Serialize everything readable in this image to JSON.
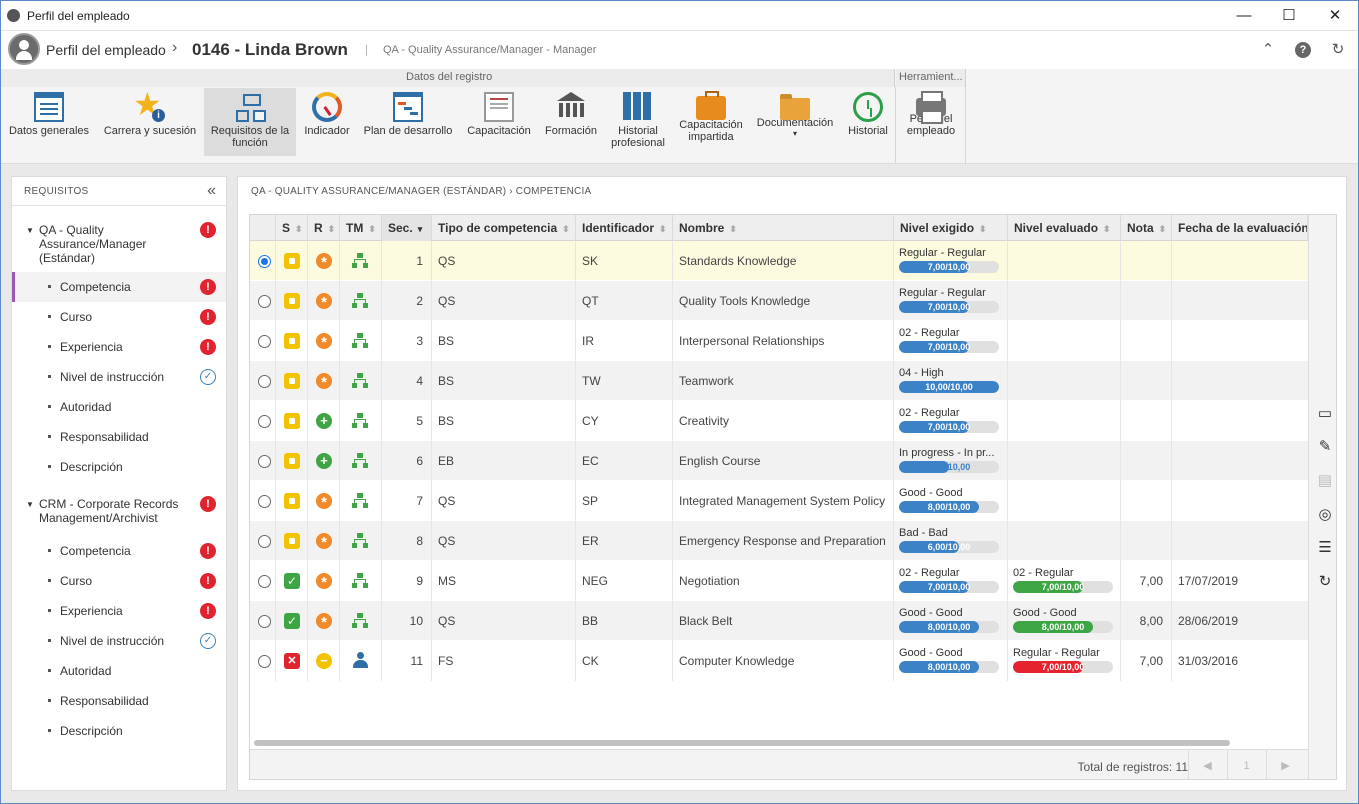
{
  "window": {
    "title": "Perfil del empleado",
    "minimize": "—",
    "maximize": "☐",
    "close": "✕"
  },
  "header": {
    "module": "Perfil del empleado",
    "chevron": "›",
    "record": "0146 - Linda Brown",
    "separator": "|",
    "subtitle": "QA - Quality Assurance/Manager - Manager",
    "icons": {
      "collapse": "⌃",
      "help": "?",
      "refresh": "↻"
    }
  },
  "ribbon": {
    "group1_label": "Datos del registro",
    "group2_label": "Herramient...",
    "buttons": [
      {
        "label": "Datos generales",
        "icon": "document-list-icon"
      },
      {
        "label": "Carrera y sucesión",
        "icon": "star-info-icon"
      },
      {
        "label": "Requisitos de la función",
        "icon": "org-tree-icon",
        "active": true
      },
      {
        "label": "Indicador",
        "icon": "gauge-icon"
      },
      {
        "label": "Plan de desarrollo",
        "icon": "plan-icon"
      },
      {
        "label": "Capacitación",
        "icon": "certificate-icon"
      },
      {
        "label": "Formación",
        "icon": "institution-icon"
      },
      {
        "label": "Historial profesional",
        "icon": "binders-icon"
      },
      {
        "label": "Capacitación impartida",
        "icon": "briefcase-icon"
      },
      {
        "label": "Documentación",
        "icon": "folder-clip-icon",
        "dropdown": "▾"
      },
      {
        "label": "Historial",
        "icon": "history-clock-icon"
      },
      {
        "label": "Perfil del empleado",
        "icon": "printer-icon"
      }
    ]
  },
  "left_panel": {
    "title": "REQUISITOS",
    "collapse": "«",
    "groups": [
      {
        "label": "QA - Quality Assurance/Manager (Estándar)",
        "status": "error",
        "items": [
          {
            "label": "Competencia",
            "status": "error",
            "selected": true
          },
          {
            "label": "Curso",
            "status": "error"
          },
          {
            "label": "Experiencia",
            "status": "error"
          },
          {
            "label": "Nivel de instrucción",
            "status": "ok"
          },
          {
            "label": "Autoridad",
            "status": ""
          },
          {
            "label": "Responsabilidad",
            "status": ""
          },
          {
            "label": "Descripción",
            "status": ""
          }
        ]
      },
      {
        "label": "CRM - Corporate Records Management/Archivist",
        "status": "error",
        "items": [
          {
            "label": "Competencia",
            "status": "error"
          },
          {
            "label": "Curso",
            "status": "error"
          },
          {
            "label": "Experiencia",
            "status": "error"
          },
          {
            "label": "Nivel de instrucción",
            "status": "ok"
          },
          {
            "label": "Autoridad",
            "status": ""
          },
          {
            "label": "Responsabilidad",
            "status": ""
          },
          {
            "label": "Descripción",
            "status": ""
          }
        ]
      }
    ],
    "glyphs": {
      "tri": "▼",
      "error": "!",
      "ok": "✓"
    }
  },
  "breadcrumb": "QA - QUALITY ASSURANCE/MANAGER (ESTÁNDAR)  ›  COMPETENCIA",
  "grid": {
    "columns": [
      "S",
      "R",
      "TM",
      "Sec.",
      "Tipo de competencia",
      "Identificador",
      "Nombre",
      "Nivel exigido",
      "Nivel evaluado",
      "Nota",
      "Fecha de la evaluación"
    ],
    "sort_glyph": "⬍",
    "sorted_glyph": "▾",
    "rows": [
      {
        "sel": true,
        "s": "y",
        "r": "o",
        "tm": "tree",
        "sec": "1",
        "tipo": "QS",
        "id": "SK",
        "nombre": "Standards Knowledge",
        "req_text": "Regular - Regular",
        "req_bar": "7,00/10,00",
        "req_pct": 0.7,
        "eval_text": "",
        "eval_bar": "",
        "eval_pct": 0,
        "eval_color": "",
        "nota": "",
        "fecha": ""
      },
      {
        "sel": false,
        "s": "y",
        "r": "o",
        "tm": "tree",
        "sec": "2",
        "tipo": "QS",
        "id": "QT",
        "nombre": "Quality Tools Knowledge",
        "req_text": "Regular - Regular",
        "req_bar": "7,00/10,00",
        "req_pct": 0.7,
        "eval_text": "",
        "eval_bar": "",
        "eval_pct": 0,
        "eval_color": "",
        "nota": "",
        "fecha": ""
      },
      {
        "sel": false,
        "s": "y",
        "r": "o",
        "tm": "tree",
        "sec": "3",
        "tipo": "BS",
        "id": "IR",
        "nombre": "Interpersonal Relationships",
        "req_text": "02 - Regular",
        "req_bar": "7,00/10,00",
        "req_pct": 0.7,
        "eval_text": "",
        "eval_bar": "",
        "eval_pct": 0,
        "eval_color": "",
        "nota": "",
        "fecha": ""
      },
      {
        "sel": false,
        "s": "y",
        "r": "o",
        "tm": "tree",
        "sec": "4",
        "tipo": "BS",
        "id": "TW",
        "nombre": "Teamwork",
        "req_text": "04 - High",
        "req_bar": "10,00/10,00",
        "req_pct": 1.0,
        "eval_text": "",
        "eval_bar": "",
        "eval_pct": 0,
        "eval_color": "",
        "nota": "",
        "fecha": ""
      },
      {
        "sel": false,
        "s": "y",
        "r": "g",
        "tm": "tree",
        "sec": "5",
        "tipo": "BS",
        "id": "CY",
        "nombre": "Creativity",
        "req_text": "02 - Regular",
        "req_bar": "7,00/10,00",
        "req_pct": 0.7,
        "eval_text": "",
        "eval_bar": "",
        "eval_pct": 0,
        "eval_color": "",
        "nota": "",
        "fecha": ""
      },
      {
        "sel": false,
        "s": "y",
        "r": "g",
        "tm": "tree",
        "sec": "6",
        "tipo": "EB",
        "id": "EC",
        "nombre": "English Course",
        "req_text": "In progress - In pr...",
        "req_bar": "5,00/10,00",
        "req_pct": 0.5,
        "eval_text": "",
        "eval_bar": "",
        "eval_pct": 0,
        "eval_color": "",
        "nota": "",
        "fecha": ""
      },
      {
        "sel": false,
        "s": "y",
        "r": "o",
        "tm": "tree",
        "sec": "7",
        "tipo": "QS",
        "id": "SP",
        "nombre": "Integrated Management System Policy",
        "req_text": "Good - Good",
        "req_bar": "8,00/10,00",
        "req_pct": 0.8,
        "eval_text": "",
        "eval_bar": "",
        "eval_pct": 0,
        "eval_color": "",
        "nota": "",
        "fecha": ""
      },
      {
        "sel": false,
        "s": "y",
        "r": "o",
        "tm": "tree",
        "sec": "8",
        "tipo": "QS",
        "id": "ER",
        "nombre": "Emergency Response and Preparation",
        "req_text": "Bad - Bad",
        "req_bar": "6,00/10,00",
        "req_pct": 0.6,
        "eval_text": "",
        "eval_bar": "",
        "eval_pct": 0,
        "eval_color": "",
        "nota": "",
        "fecha": ""
      },
      {
        "sel": false,
        "s": "g",
        "r": "o",
        "tm": "tree",
        "sec": "9",
        "tipo": "MS",
        "id": "NEG",
        "nombre": "Negotiation",
        "req_text": "02 - Regular",
        "req_bar": "7,00/10,00",
        "req_pct": 0.7,
        "eval_text": "02 - Regular",
        "eval_bar": "7,00/10,00",
        "eval_pct": 0.7,
        "eval_color": "green",
        "nota": "7,00",
        "fecha": "17/07/2019"
      },
      {
        "sel": false,
        "s": "g",
        "r": "o",
        "tm": "tree",
        "sec": "10",
        "tipo": "QS",
        "id": "BB",
        "nombre": "Black Belt",
        "req_text": "Good - Good",
        "req_bar": "8,00/10,00",
        "req_pct": 0.8,
        "eval_text": "Good - Good",
        "eval_bar": "8,00/10,00",
        "eval_pct": 0.8,
        "eval_color": "green",
        "nota": "8,00",
        "fecha": "28/06/2019"
      },
      {
        "sel": false,
        "s": "r",
        "r": "y",
        "tm": "person",
        "sec": "11",
        "tipo": "FS",
        "id": "CK",
        "nombre": "Computer Knowledge",
        "req_text": "Good - Good",
        "req_bar": "8,00/10,00",
        "req_pct": 0.8,
        "eval_text": "Regular - Regular",
        "eval_bar": "7,00/10,00",
        "eval_pct": 0.7,
        "eval_color": "red",
        "nota": "7,00",
        "fecha": "31/03/2016"
      }
    ],
    "footer": {
      "total": "Total de registros: 11",
      "prev": "◀",
      "page": "1",
      "next": "▶"
    },
    "side_tools": [
      {
        "icon": "view-details-icon",
        "glyph": "▭"
      },
      {
        "icon": "evaluate-badge-icon",
        "glyph": "✎"
      },
      {
        "icon": "certificate-disabled-icon",
        "glyph": "▤"
      },
      {
        "icon": "target-icon",
        "glyph": "◎"
      },
      {
        "icon": "list-icon",
        "glyph": "☰"
      },
      {
        "icon": "refresh-icon",
        "glyph": "↻"
      }
    ]
  }
}
